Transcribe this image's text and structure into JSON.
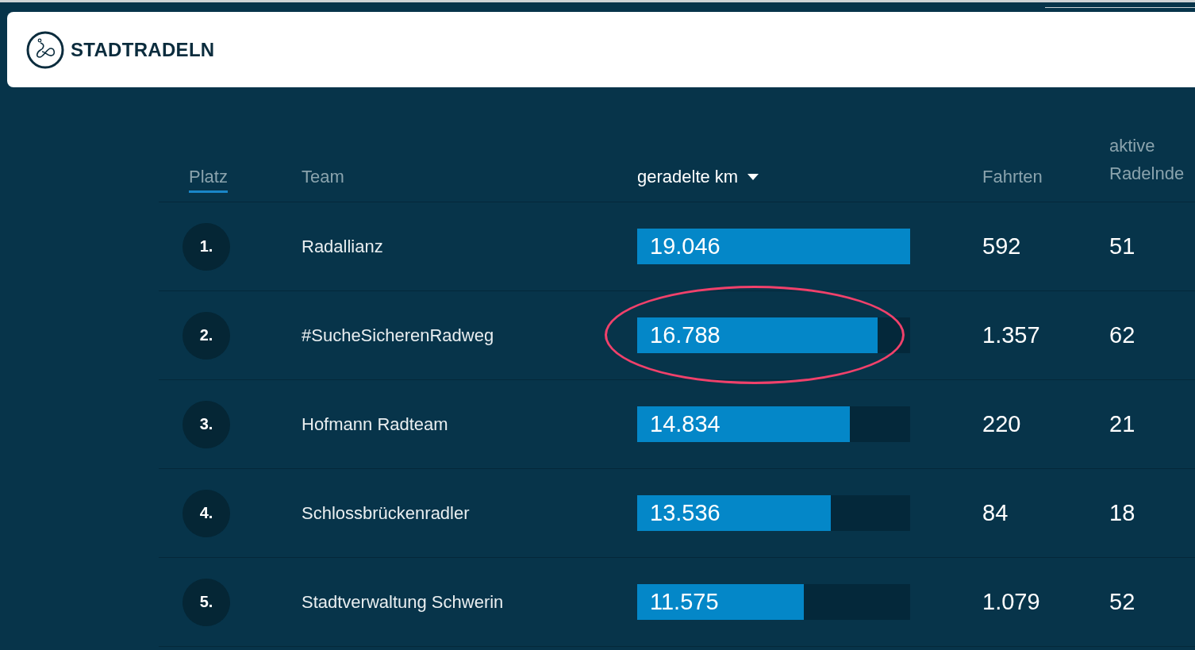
{
  "header": {
    "logo_text": "STADTRADELN"
  },
  "table": {
    "columns": [
      {
        "label": "Platz",
        "selected": true,
        "sorted": false
      },
      {
        "label": "Team",
        "selected": false,
        "sorted": false
      },
      {
        "label": "geradelte km",
        "selected": false,
        "sorted": true
      },
      {
        "label": "Fahrten",
        "selected": false,
        "sorted": false
      },
      {
        "label": "aktive Radelnde",
        "selected": false,
        "sorted": false
      }
    ],
    "rows": [
      {
        "rank": "1.",
        "team": "Radallianz",
        "km": "19.046",
        "level": 1.0,
        "trips": "592",
        "active": "51",
        "circled": false
      },
      {
        "rank": "2.",
        "team": "#SucheSicherenRadweg",
        "km": "16.788",
        "level": 0.88,
        "trips": "1.357",
        "active": "62",
        "circled": true
      },
      {
        "rank": "3.",
        "team": "Hofmann Radteam",
        "km": "14.834",
        "level": 0.78,
        "trips": "220",
        "active": "21",
        "circled": false
      },
      {
        "rank": "4.",
        "team": "Schlossbrückenradler",
        "km": "13.536",
        "level": 0.71,
        "trips": "84",
        "active": "18",
        "circled": false
      },
      {
        "rank": "5.",
        "team": "Stadtverwaltung Schwerin",
        "km": "11.575",
        "level": 0.61,
        "trips": "1.079",
        "active": "52",
        "circled": false
      }
    ]
  }
}
